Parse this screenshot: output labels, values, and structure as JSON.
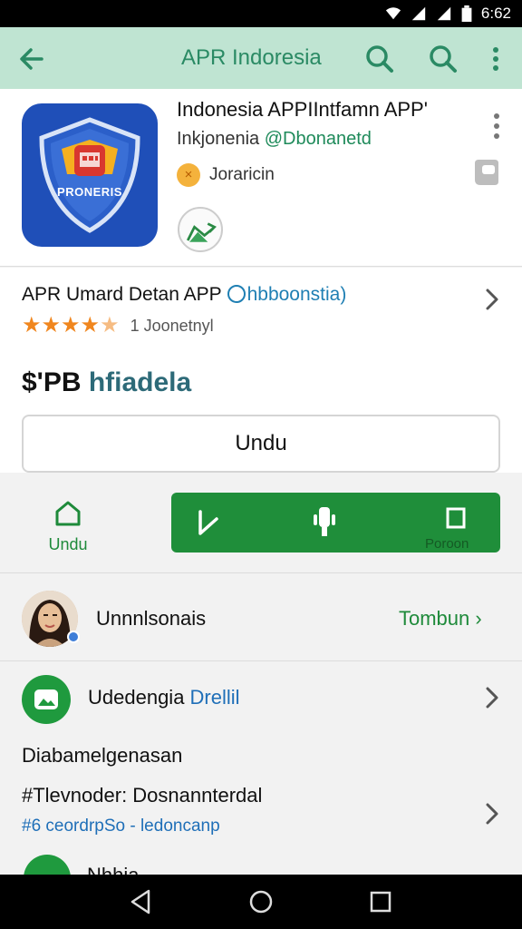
{
  "status": {
    "time": "6:62"
  },
  "appbar": {
    "title": "APR Indoresia"
  },
  "app": {
    "icon_label": "PRONERIS",
    "name": "Indonesia APPIIntfamn APP'",
    "developer_prefix": "Inkjonenia ",
    "developer_handle": "@Dbonanetd",
    "category_glyph": "×",
    "category": "Joraricin"
  },
  "info": {
    "subtitle": "APR Umard Detan APP",
    "subtitle_tag": "hbboonstia)",
    "rating": 4.5,
    "reviews": "1 Joonetnyl",
    "price_prefix": "$'PB ",
    "price_sub": "hfiadela",
    "download_label": "Undu"
  },
  "actions": {
    "side_label": "Undu",
    "green_label": "Poroon"
  },
  "user": {
    "name": "Unnnlsonais",
    "link": "Tombun"
  },
  "linkrow": {
    "title": "Udedengia ",
    "title_hl": "Drellil",
    "desc": "Diabamelgenasan",
    "meta": "#Tlevnoder: Dosnannterdal",
    "meta2": "#6 ceordrpSo - ledoncanp",
    "peek_text": "Nhhia"
  },
  "colors": {
    "appbar_bg": "#bfe4d2",
    "accent_green": "#1f8e3a",
    "link_blue": "#1f6fb8",
    "star_orange": "#f0861e"
  }
}
